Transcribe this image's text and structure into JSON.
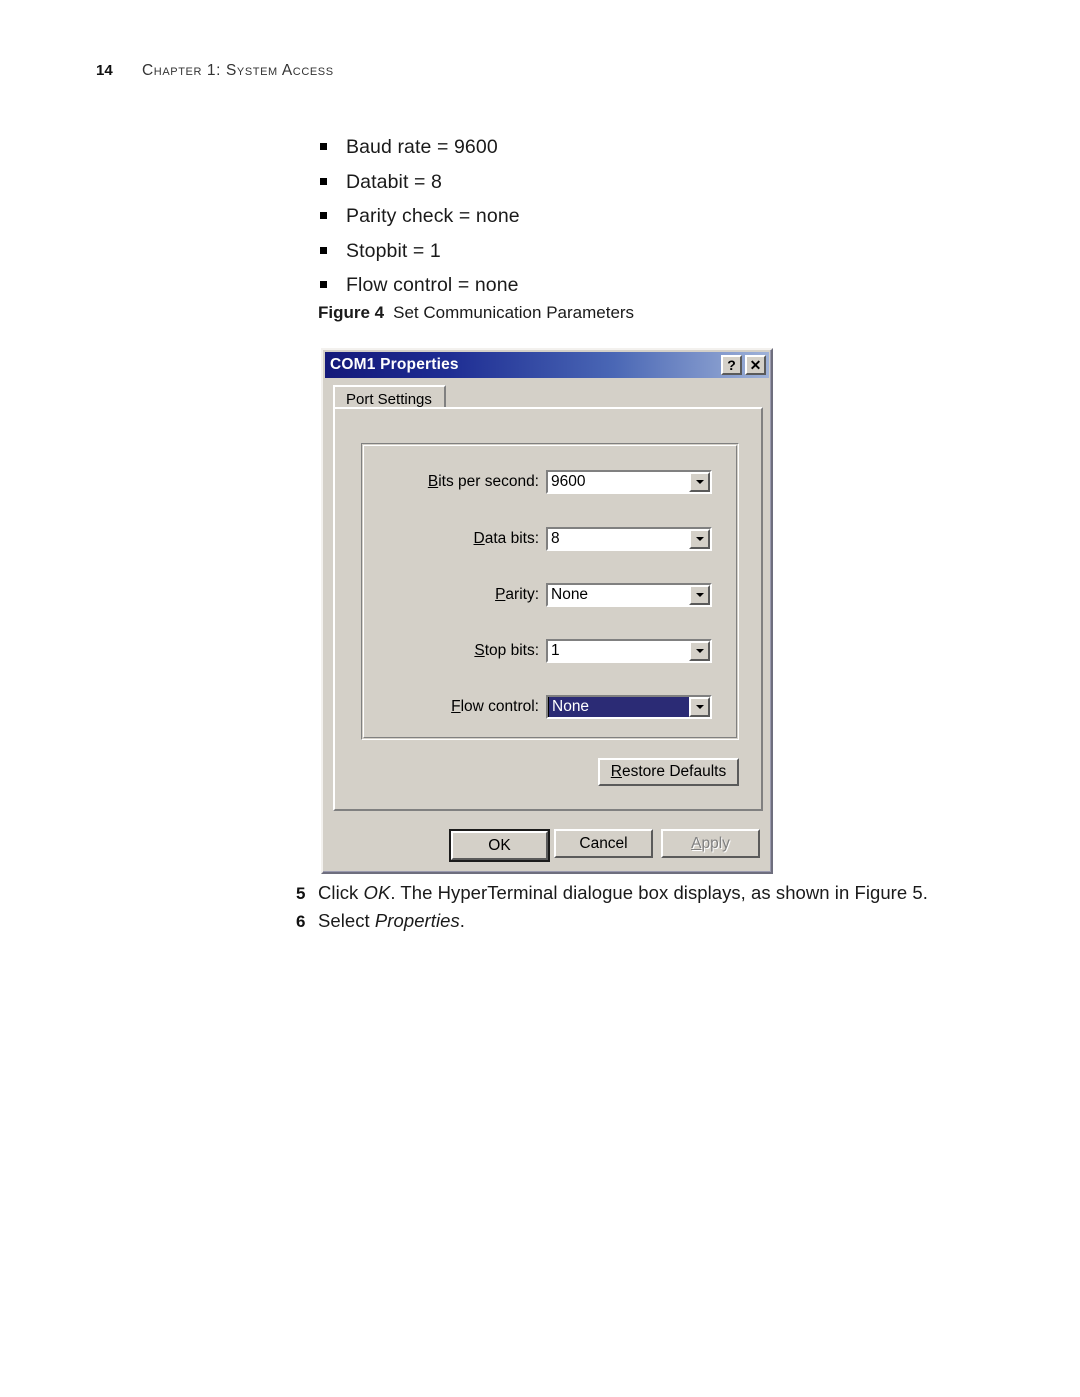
{
  "page": {
    "number": "14",
    "chapter": "Chapter 1: System Access"
  },
  "bullets": [
    {
      "text": "Baud rate = 9600"
    },
    {
      "text": "Databit = 8"
    },
    {
      "text": "Parity check = none"
    },
    {
      "text": "Stopbit = 1"
    },
    {
      "text": "Flow control = none"
    }
  ],
  "figure": {
    "label": "Figure 4",
    "caption": "Set Communication Parameters"
  },
  "dialog": {
    "title": "COM1 Properties",
    "help_button": "?",
    "close_button": "✕",
    "tab": "Port Settings",
    "fields": [
      {
        "label_prefix": "",
        "label_accel": "B",
        "label_rest": "its per second:",
        "value": "9600",
        "selected": false
      },
      {
        "label_prefix": "",
        "label_accel": "D",
        "label_rest": "ata bits:",
        "value": "8",
        "selected": false
      },
      {
        "label_prefix": "",
        "label_accel": "P",
        "label_rest": "arity:",
        "value": "None",
        "selected": false
      },
      {
        "label_prefix": "",
        "label_accel": "S",
        "label_rest": "top bits:",
        "value": "1",
        "selected": false
      },
      {
        "label_prefix": "",
        "label_accel": "F",
        "label_rest": "low control:",
        "value": "None",
        "selected": true
      }
    ],
    "restore_defaults": {
      "accel": "R",
      "rest": "estore Defaults"
    },
    "ok": "OK",
    "cancel": "Cancel",
    "apply": {
      "accel": "A",
      "rest": "pply"
    },
    "colors": {
      "face": "#d4d0c8",
      "titlebar_start": "#14197a",
      "titlebar_end": "#9fb2d8",
      "selection": "#2b2b75"
    }
  },
  "steps": [
    {
      "num": "5",
      "html": "Click <i>OK</i>. The HyperTerminal dialogue box displays, as shown in Figure 5."
    },
    {
      "num": "6",
      "html": "Select <i>Properties</i>."
    }
  ]
}
